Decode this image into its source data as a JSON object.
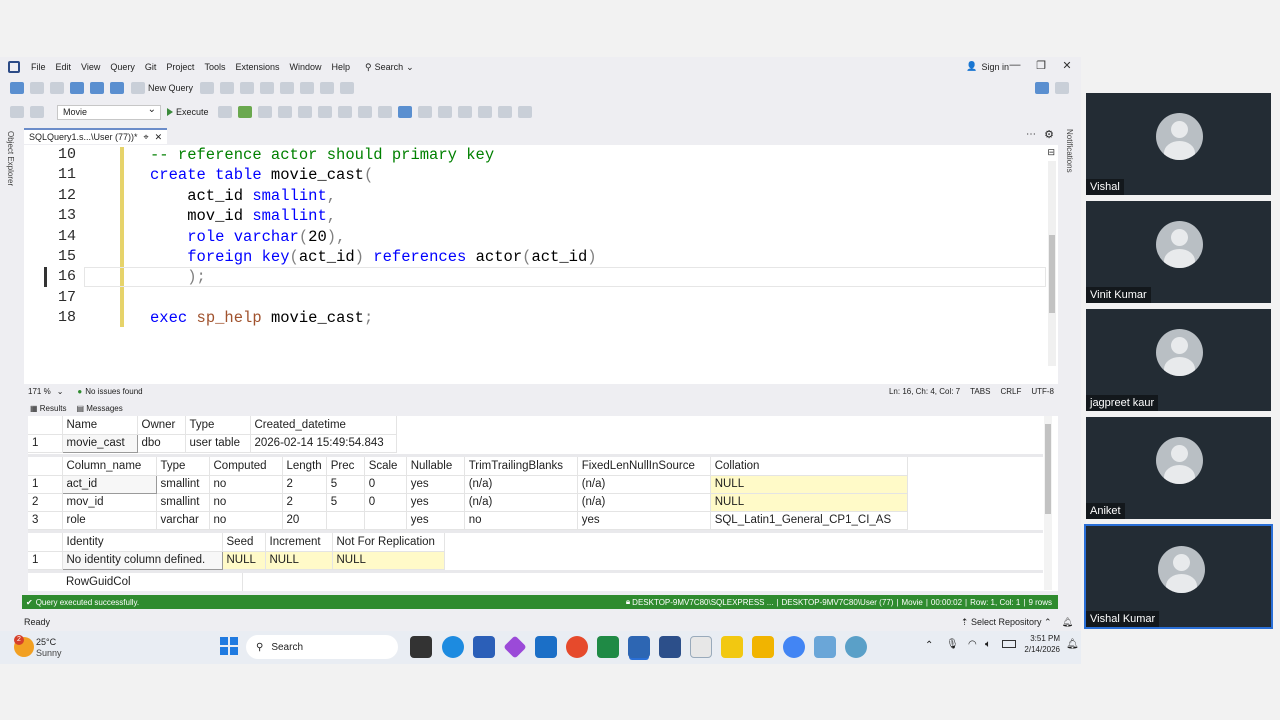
{
  "menu": {
    "items": [
      "File",
      "Edit",
      "View",
      "Query",
      "Git",
      "Project",
      "Tools",
      "Extensions",
      "Window",
      "Help"
    ],
    "search_label": "Search",
    "signin_label": "Sign in"
  },
  "toolbar": {
    "new_query_label": "New Query",
    "database": "Movie",
    "execute_label": "Execute"
  },
  "side": {
    "left_label": "Object Explorer",
    "right_label": "Notifications"
  },
  "tab": {
    "title": "SQLQuery1.s...\\User (77))*"
  },
  "editor": {
    "lines": [
      {
        "num": "10",
        "html": "<span class='cm'>-- reference actor should primary key</span>"
      },
      {
        "num": "11",
        "html": "<span class='kw'>create table</span> movie_cast<span class='gr'>(</span>"
      },
      {
        "num": "12",
        "html": "    act_id <span class='kw'>smallint</span><span class='gr'>,</span>"
      },
      {
        "num": "13",
        "html": "    mov_id <span class='kw'>smallint</span><span class='gr'>,</span>"
      },
      {
        "num": "14",
        "html": "    <span class='kw'>role varchar</span><span class='gr'>(</span>20<span class='gr'>),</span>"
      },
      {
        "num": "15",
        "html": "    <span class='kw'>foreign key</span><span class='gr'>(</span>act_id<span class='gr'>)</span> <span class='kw'>references</span> actor<span class='gr'>(</span>act_id<span class='gr'>)</span>"
      },
      {
        "num": "16",
        "html": "    <span class='gr'>);</span>"
      },
      {
        "num": "17",
        "html": ""
      },
      {
        "num": "18",
        "html": "<span class='kw'>exec</span> <span class='fn'>sp_help</span> movie_cast<span class='gr'>;</span>"
      }
    ]
  },
  "editor_status": {
    "zoom": "171 %",
    "issues": "No issues found",
    "position": "Ln: 16, Ch: 4, Col: 7",
    "tabs": "TABS",
    "eol": "CRLF",
    "encoding": "UTF-8"
  },
  "result_tabs": {
    "results": "Results",
    "messages": "Messages"
  },
  "grid1": {
    "headers": [
      "Name",
      "Owner",
      "Type",
      "Created_datetime"
    ],
    "rows": [
      [
        "1",
        "movie_cast",
        "dbo",
        "user table",
        "2026-02-14 15:49:54.843"
      ]
    ]
  },
  "grid2": {
    "headers": [
      "Column_name",
      "Type",
      "Computed",
      "Length",
      "Prec",
      "Scale",
      "Nullable",
      "TrimTrailingBlanks",
      "FixedLenNullInSource",
      "Collation"
    ],
    "rows": [
      [
        "1",
        "act_id",
        "smallint",
        "no",
        "2",
        "5",
        "0",
        "yes",
        "(n/a)",
        "(n/a)",
        "NULL"
      ],
      [
        "2",
        "mov_id",
        "smallint",
        "no",
        "2",
        "5",
        "0",
        "yes",
        "(n/a)",
        "(n/a)",
        "NULL"
      ],
      [
        "3",
        "role",
        "varchar",
        "no",
        "20",
        "",
        "",
        "yes",
        "no",
        "yes",
        "SQL_Latin1_General_CP1_CI_AS"
      ]
    ]
  },
  "grid3": {
    "headers": [
      "Identity",
      "Seed",
      "Increment",
      "Not For Replication"
    ],
    "rows": [
      [
        "1",
        "No identity column defined.",
        "NULL",
        "NULL",
        "NULL"
      ]
    ]
  },
  "grid4": {
    "headers": [
      "RowGuidCol"
    ]
  },
  "query_status": {
    "message": "Query executed successfully.",
    "server": "DESKTOP-9MV7C80\\SQLEXPRESS ...",
    "user": "DESKTOP-9MV7C80\\User (77)",
    "db": "Movie",
    "time": "00:00:02",
    "rowcol": "Row: 1, Col: 1",
    "rows": "9 rows"
  },
  "ready": {
    "text": "Ready",
    "repo": "Select Repository"
  },
  "taskbar": {
    "temp": "25°C",
    "weather": "Sunny",
    "weather_badge": "2",
    "search_label": "Search",
    "time": "3:51 PM",
    "date": "2/14/2026"
  },
  "participants": [
    {
      "name": "Vishal"
    },
    {
      "name": "Vinit Kumar"
    },
    {
      "name": "jagpreet kaur"
    },
    {
      "name": "Aniket"
    },
    {
      "name": "Vishal Kumar"
    }
  ]
}
